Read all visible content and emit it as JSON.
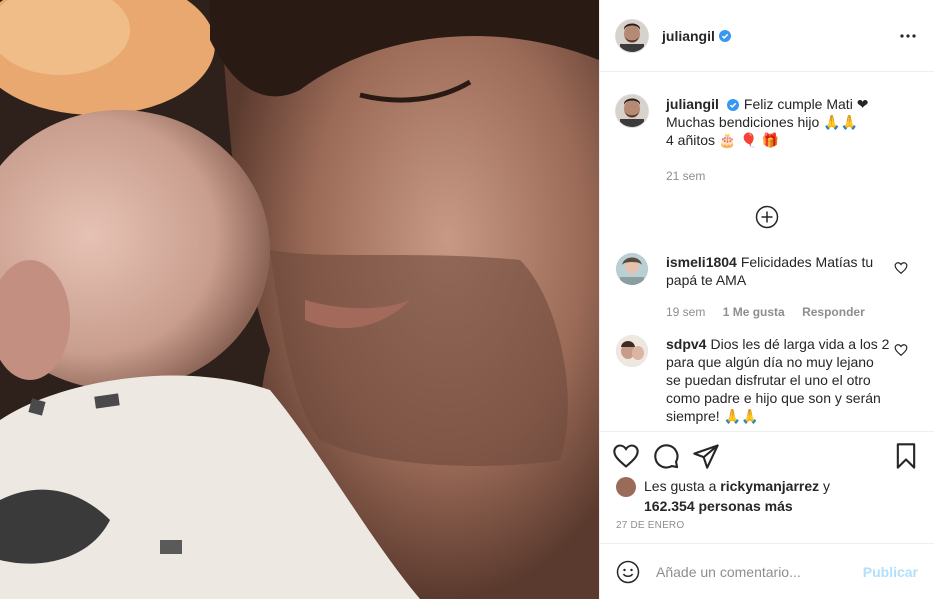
{
  "post": {
    "username": "juliangil",
    "photo_description_icon": "photo-of-father-and-baby"
  },
  "header": {
    "username": "juliangil",
    "more_icon": "more-horizontal-icon"
  },
  "caption": {
    "username": "juliangil",
    "line1": "Feliz cumple Mati ❤",
    "line2": "Muchas bendiciones hijo 🙏🙏",
    "line3": "4 añitos 🎂 🎈 🎁",
    "time": "21 sem"
  },
  "load_more_icon": "plus-circle-icon",
  "comments": [
    {
      "username": "ismeli1804",
      "text": "Felicidades Matías tu papá te AMA",
      "time": "19 sem",
      "likes": "1 Me gusta",
      "reply": "Responder"
    },
    {
      "username": "sdpv4",
      "text": "Dios les dé larga vida a los 2 para que algún día no muy lejano se puedan disfrutar el uno el otro como padre e hijo que son y serán siempre! 🙏🙏",
      "time": "",
      "likes": "",
      "reply": ""
    }
  ],
  "actions": {
    "like_icon": "heart-icon",
    "comment_icon": "comment-icon",
    "share_icon": "paper-plane-icon",
    "save_icon": "bookmark-icon"
  },
  "likes": {
    "prefix": "Les gusta a",
    "user": "rickymanjarrez",
    "joiner": "y",
    "count": "162.354 personas más"
  },
  "date": "27 DE ENERO",
  "add_comment": {
    "placeholder": "Añade un comentario...",
    "publish": "Publicar",
    "emoji_icon": "smiley-icon"
  },
  "colors": {
    "verified": "#3897f0",
    "publish_disabled": "#b2dffc",
    "muted_text": "#8e8e8e"
  }
}
